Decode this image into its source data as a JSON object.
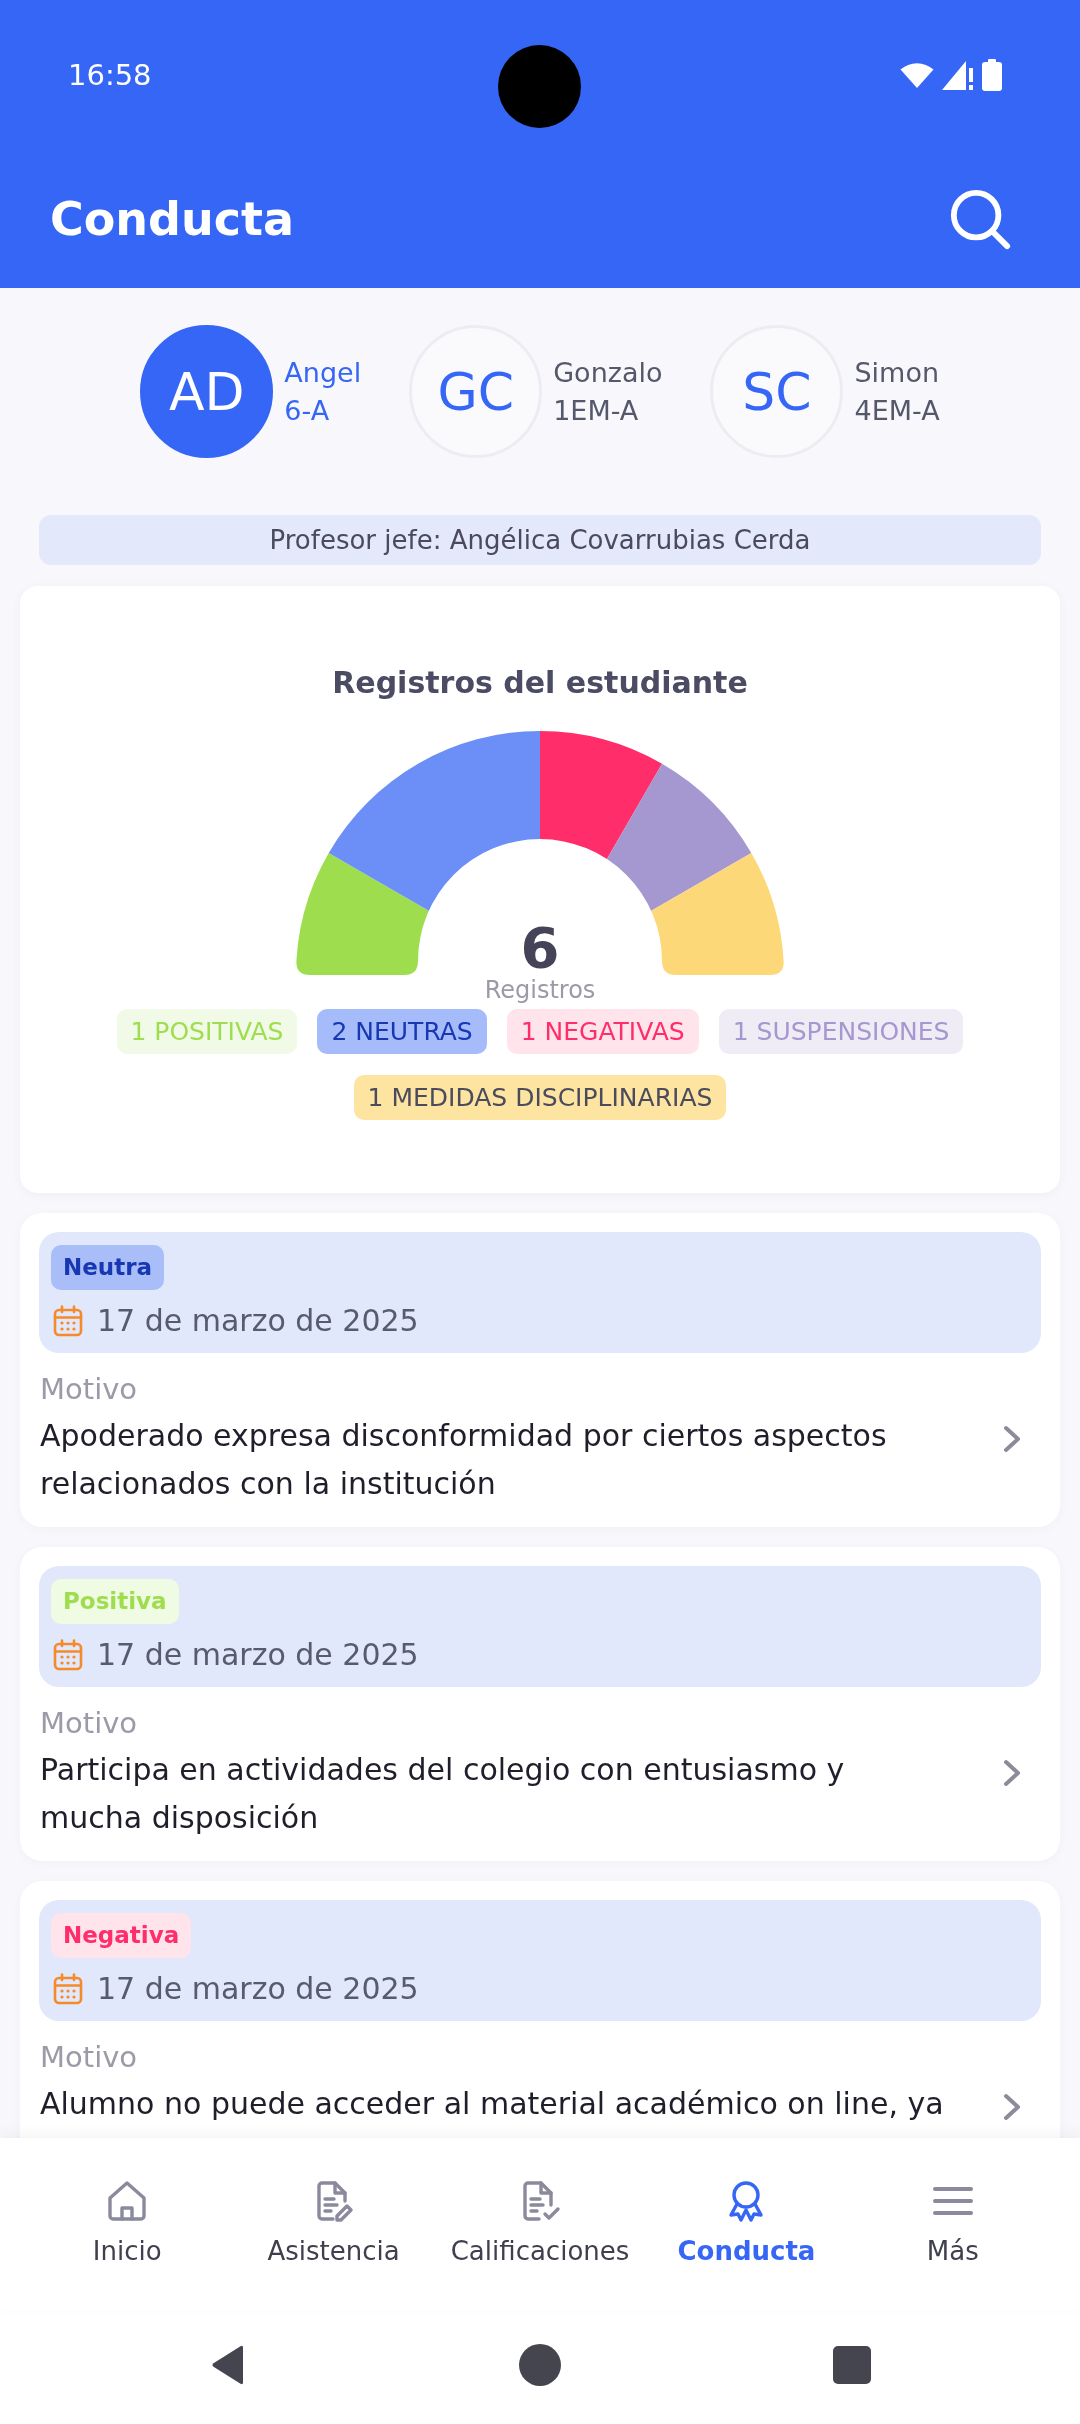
{
  "status_bar": {
    "time": "16:58"
  },
  "header": {
    "title": "Conducta"
  },
  "students": [
    {
      "initials": "AD",
      "name": "Angel",
      "course": "6-A",
      "selected": true
    },
    {
      "initials": "GC",
      "name": "Gonzalo",
      "course": "1EM-A",
      "selected": false
    },
    {
      "initials": "SC",
      "name": "Simon",
      "course": "4EM-A",
      "selected": false
    }
  ],
  "teacher_banner": "Profesor jefe: Angélica Covarrubias Cerda",
  "chart": {
    "chart_data": {
      "type": "donut",
      "title": "Registros del estudiante",
      "values": [
        16.67,
        33.33,
        16.67,
        16.67,
        16.66
      ]
    },
    "total": "6",
    "total_label": "Registros",
    "tags": [
      {
        "label": "1 POSITIVAS",
        "kind": "positive",
        "color": "#9ede4e"
      },
      {
        "label": "2 NEUTRAS",
        "kind": "neutral",
        "color": "#6b8ff7"
      },
      {
        "label": "1 NEGATIVAS",
        "kind": "negative",
        "color": "#ff2d6a"
      },
      {
        "label": "1 SUSPENSIONES",
        "kind": "suspension",
        "color": "#a597cf"
      },
      {
        "label": "1 MEDIDAS DISCIPLINARIAS",
        "kind": "disciplinary",
        "color": "#fdd878"
      }
    ]
  },
  "records": [
    {
      "kind": "neutral",
      "type": "Neutra",
      "date": "17 de marzo de 2025",
      "reason_label": "Motivo",
      "reason": "Apoderado expresa disconformidad por ciertos aspectos relacionados con la institución"
    },
    {
      "kind": "positive",
      "type": "Positiva",
      "date": "17 de marzo de 2025",
      "reason_label": "Motivo",
      "reason": "Participa en actividades del colegio con entusiasmo y mucha disposición"
    },
    {
      "kind": "negative",
      "type": "Negativa",
      "date": "17 de marzo de 2025",
      "reason_label": "Motivo",
      "reason": "Alumno no puede acceder al material académico on line, ya"
    }
  ],
  "bottom_nav": [
    {
      "kind": "home",
      "label": "Inicio",
      "selected": false
    },
    {
      "kind": "attendance",
      "label": "Asistencia",
      "selected": false
    },
    {
      "kind": "grades",
      "label": "Calificaciones",
      "selected": false
    },
    {
      "kind": "conduct",
      "label": "Conducta",
      "selected": true
    },
    {
      "kind": "more",
      "label": "Más",
      "selected": false
    }
  ]
}
